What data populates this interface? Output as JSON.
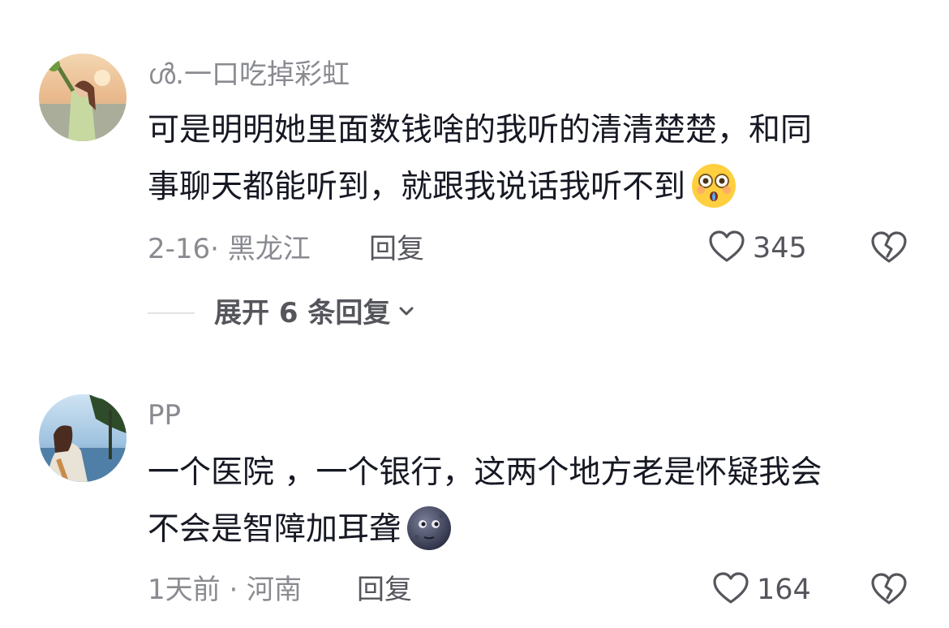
{
  "comments": [
    {
      "username": "ൾ.一口吃掉彩虹",
      "text_line1": "可是明明她里面数钱啥的我听的清清楚楚，和同",
      "text_line2": "事聊天都能听到，就跟我说话我听不到",
      "emoji": "flushed-face-emoji",
      "meta": "2-16· 黑龙江",
      "reply_label": "回复",
      "likes": "345",
      "expand_label": "展开 6 条回复"
    },
    {
      "username": "PP",
      "text_line1": "一个医院 ，一个银行，这两个地方老是怀疑我会",
      "text_line2": "不会是智障加耳聋",
      "emoji": "new-moon-face-emoji",
      "meta": "1天前 · 河南",
      "reply_label": "回复",
      "likes": "164"
    }
  ],
  "colors": {
    "text": "#161823",
    "secondary": "#8a8b91",
    "action": "#55565c"
  }
}
